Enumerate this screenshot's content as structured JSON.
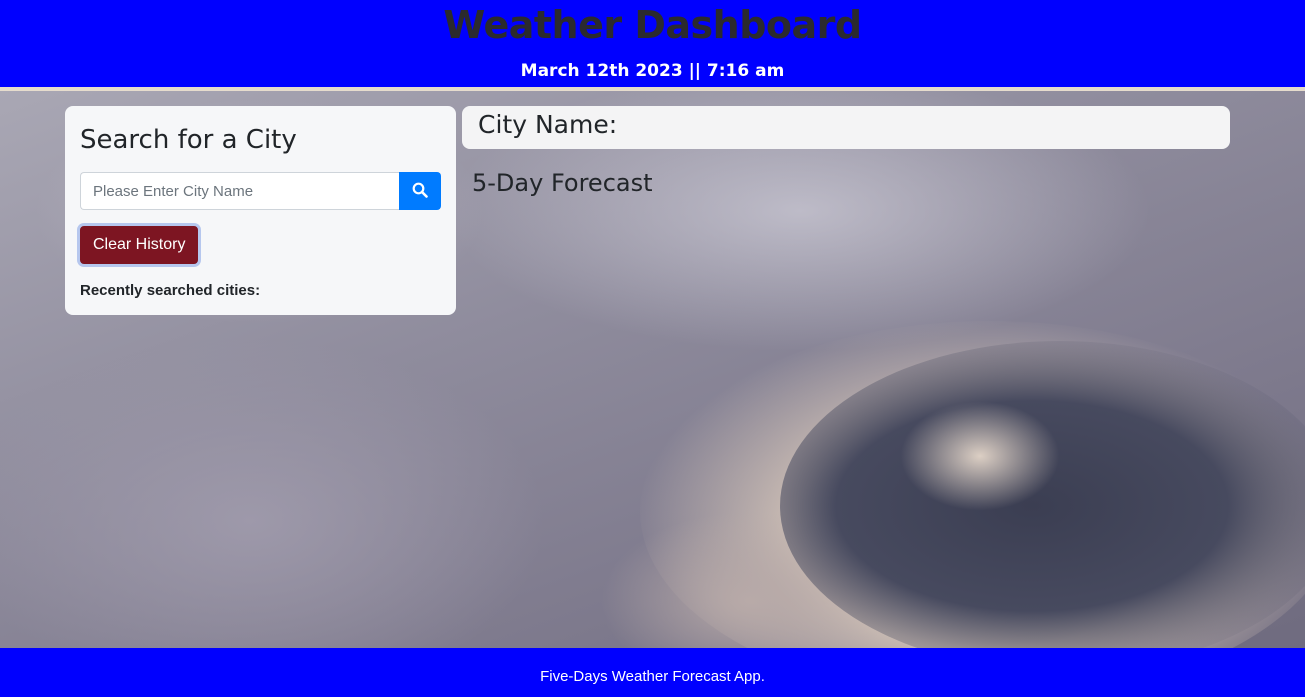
{
  "header": {
    "title": "Weather Dashboard",
    "datetime": "March 12th 2023 || 7:16 am"
  },
  "search": {
    "heading": "Search for a City",
    "placeholder": "Please Enter City Name",
    "value": "",
    "search_icon": "search-icon",
    "clear_label": "Clear History",
    "recent_label": "Recently searched cities:"
  },
  "main": {
    "city_label": "City Name:",
    "forecast_title": "5-Day Forecast"
  },
  "footer": {
    "text": "Five-Days Weather Forecast App."
  },
  "colors": {
    "header_bg": "#0000ff",
    "footer_bg": "#0000ff",
    "search_button": "#007bff",
    "clear_button": "#7d1522"
  }
}
